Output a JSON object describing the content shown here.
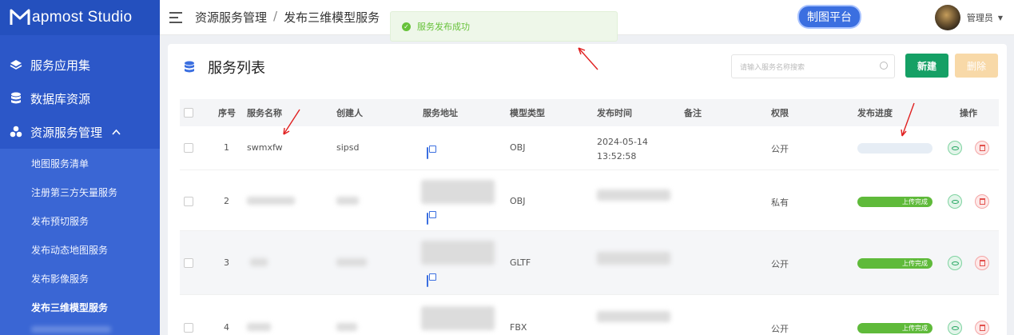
{
  "sidebar": {
    "brand": "apmost Studio",
    "items": [
      {
        "label": "服务应用集",
        "icon": "layers-icon"
      },
      {
        "label": "数据库资源",
        "icon": "database-icon"
      }
    ],
    "group": {
      "label": "资源服务管理",
      "icon": "cluster-icon",
      "expanded": true,
      "children": [
        {
          "label": "地图服务清单",
          "active": false
        },
        {
          "label": "注册第三方矢量服务",
          "active": false
        },
        {
          "label": "发布预切服务",
          "active": false
        },
        {
          "label": "发布动态地图服务",
          "active": false
        },
        {
          "label": "发布影像服务",
          "active": false
        },
        {
          "label": "发布三维模型服务",
          "active": true
        }
      ]
    }
  },
  "header": {
    "breadcrumb": [
      "资源服务管理",
      "发布三维模型服务"
    ],
    "toast": "服务发布成功",
    "map_platform": "制图平台",
    "user": "管理员"
  },
  "main": {
    "title": "服务列表",
    "search_placeholder": "请输入服务名称搜索",
    "new_label": "新建",
    "delete_label": "删除",
    "columns": [
      "序号",
      "服务名称",
      "创建人",
      "服务地址",
      "模型类型",
      "发布时间",
      "备注",
      "权限",
      "发布进度",
      "操作"
    ],
    "rows": [
      {
        "index": "1",
        "name": "swmxfw",
        "creator": "sipsd",
        "type": "OBJ",
        "time": "2024-05-14 13:52:58",
        "permission": "公开",
        "progress_label": "",
        "progress": 0
      },
      {
        "index": "2",
        "name": "",
        "creator": "",
        "type": "OBJ",
        "time": "",
        "permission": "私有",
        "progress_label": "上传完成",
        "progress": 1
      },
      {
        "index": "3",
        "name": "",
        "creator": "",
        "type": "GLTF",
        "time": "",
        "permission": "公开",
        "progress_label": "上传完成",
        "progress": 1
      },
      {
        "index": "4",
        "name": "",
        "creator": "",
        "type": "FBX",
        "time": "",
        "permission": "公开",
        "progress_label": "上传完成",
        "progress": 1
      }
    ]
  },
  "colors": {
    "sidebar": "#2c57c8",
    "accent": "#3b6fe0",
    "success": "#15a065",
    "annotation": "#e02020"
  }
}
